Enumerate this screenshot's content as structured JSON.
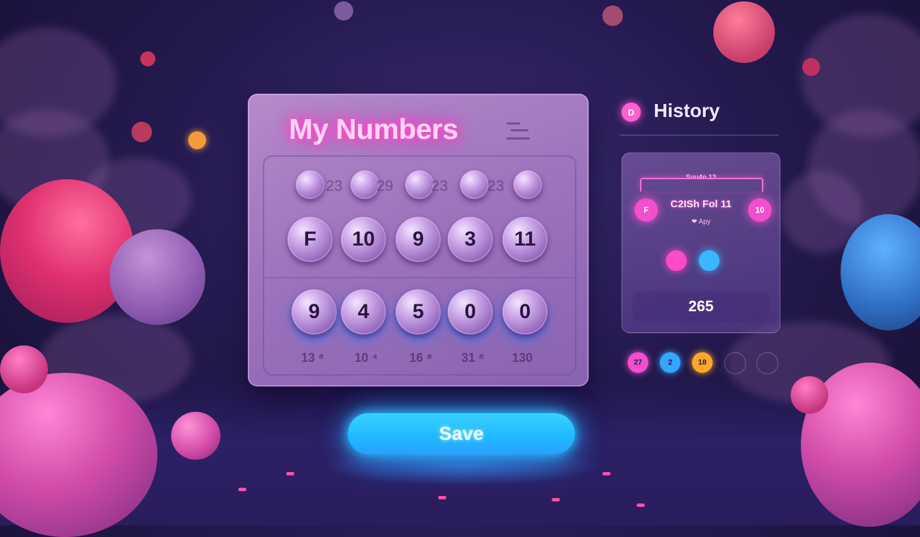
{
  "main_card": {
    "title": "My Numbers",
    "top_row": {
      "labels": [
        "23",
        "29",
        "23",
        "23"
      ]
    },
    "middle_row": [
      "F",
      "10",
      "9",
      "3",
      "11"
    ],
    "bottom_row": [
      "9",
      "4",
      "5",
      "0",
      "0"
    ],
    "bottom_labels": [
      "13 ⁸",
      "10 ⁴",
      "16 ⁸",
      "31 ⁸",
      "130"
    ]
  },
  "history": {
    "title": "History",
    "icon_letter": "D",
    "card": {
      "header": "Suu4o 13",
      "left_ball": "F",
      "right_ball": "10",
      "text": "C2ISh Fol 11",
      "small": "❤ Apy",
      "dots": [
        "#ff49c8",
        "#3ab8ff"
      ],
      "value": "265"
    },
    "chips": [
      {
        "label": "27",
        "color": "#f14fcf"
      },
      {
        "label": "2",
        "color": "#33a6ff"
      },
      {
        "label": "18",
        "color": "#ffa72b"
      },
      {
        "label": "",
        "color": ""
      },
      {
        "label": "",
        "color": ""
      }
    ]
  },
  "save_button": {
    "label": "Save"
  }
}
